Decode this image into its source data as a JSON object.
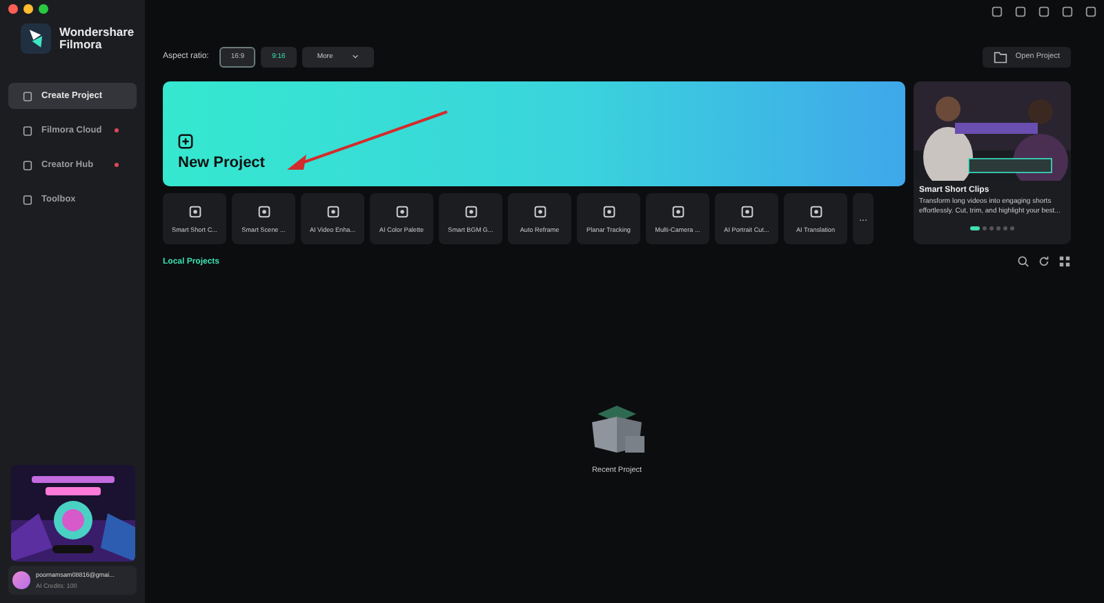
{
  "app": {
    "name": "Wondershare",
    "subname": "Filmora"
  },
  "sidebar": {
    "items": [
      {
        "label": "Create Project",
        "selected": true,
        "dot": false
      },
      {
        "label": "Filmora Cloud",
        "selected": false,
        "dot": true
      },
      {
        "label": "Creator Hub",
        "selected": false,
        "dot": true
      },
      {
        "label": "Toolbox",
        "selected": false,
        "dot": false
      }
    ]
  },
  "account": {
    "email": "poornamsam08816@gmai...",
    "credits": "AI Credits: 100"
  },
  "aspect": {
    "label": "Aspect ratio:",
    "options": [
      {
        "label": "16:9",
        "selected": true
      },
      {
        "label": "9:16",
        "selected": false
      }
    ],
    "more": "More"
  },
  "open_project": "Open Project",
  "new_project": "New Project",
  "tools": [
    {
      "label": "Smart Short C..."
    },
    {
      "label": "Smart Scene ..."
    },
    {
      "label": "AI Video Enha..."
    },
    {
      "label": "AI Color Palette"
    },
    {
      "label": "Smart BGM G..."
    },
    {
      "label": "Auto Reframe"
    },
    {
      "label": "Planar Tracking"
    },
    {
      "label": "Multi-Camera ..."
    },
    {
      "label": "AI Portrait Cut..."
    },
    {
      "label": "AI Translation"
    }
  ],
  "more_tools": "...",
  "feature": {
    "title": "Smart Short Clips",
    "description": "Transform long videos into engaging shorts effortlessly. Cut, trim, and highlight your best...",
    "slides": [
      {
        "selected": true
      },
      {
        "selected": false
      },
      {
        "selected": false
      },
      {
        "selected": false
      },
      {
        "selected": false
      },
      {
        "selected": false
      }
    ]
  },
  "local_projects": {
    "title": "Local Projects",
    "empty": "Recent Project"
  }
}
